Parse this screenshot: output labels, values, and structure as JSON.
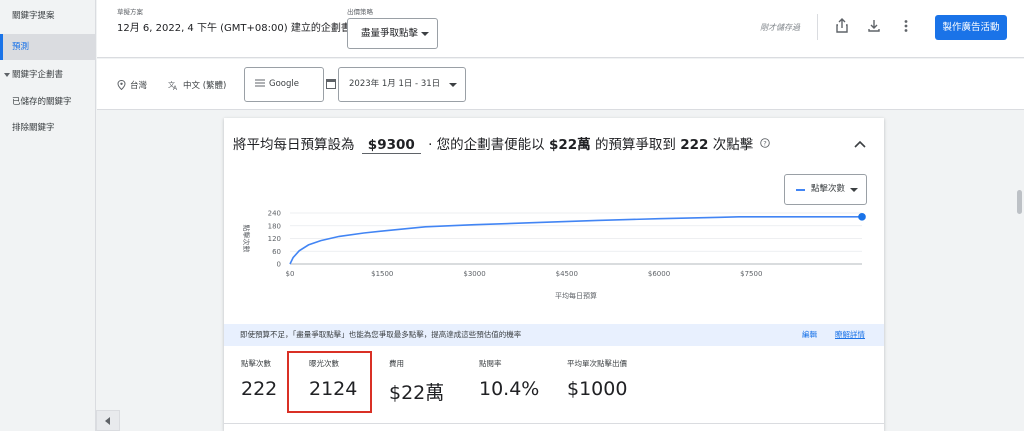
{
  "sidebar": {
    "items": [
      {
        "label": "關鍵字提案"
      },
      {
        "label": "預測",
        "active": true
      },
      {
        "label": "關鍵字企劃書"
      },
      {
        "label": "已儲存的關鍵字"
      },
      {
        "label": "排除關鍵字"
      }
    ]
  },
  "header": {
    "plan_label": "草擬方案",
    "plan_title": "12月 6, 2022, 4 下午 (GMT+08:00) 建立的企劃書",
    "strategy_label": "出價策略",
    "strategy_value": "盡量爭取點擊",
    "saved_text": "剛才儲存過",
    "create_button": "製作廣告活動"
  },
  "filters": {
    "location": "台灣",
    "language": "中文 (繁體)",
    "network": "Google",
    "date_range": "2023年 1月 1日 - 31日"
  },
  "forecast": {
    "headline_prefix": "將平均每日預算設為",
    "budget": "$9300",
    "headline_mid": "· 您的企劃書便能以",
    "spend": "$22萬",
    "headline_mid2": "的預算爭取到",
    "clicks": "222",
    "headline_suffix": "次點擊",
    "metric_select": "點擊次數",
    "info_text": "即使預算不足，「盡量爭取點擊」也能為您爭取最多點擊，提高達成這些預估值的機率",
    "info_edit": "編輯",
    "info_learn": "瞭解詳情"
  },
  "metrics": [
    {
      "label": "點擊次數",
      "value": "222"
    },
    {
      "label": "曝光次數",
      "value": "2124"
    },
    {
      "label": "費用",
      "value": "$22萬"
    },
    {
      "label": "點閱率",
      "value": "10.4%"
    },
    {
      "label": "平均單次點擊出價",
      "value": "$1000"
    }
  ],
  "chart_data": {
    "type": "line",
    "xlabel": "平均每日預算",
    "ylabel": "點擊次數",
    "x_ticks": [
      "$0",
      "$1500",
      "$3000",
      "$4500",
      "$6000",
      "$7500"
    ],
    "x_tick_values": [
      0,
      1500,
      3000,
      4500,
      6000,
      7500
    ],
    "y_ticks": [
      "0",
      "60",
      "120",
      "180",
      "240"
    ],
    "y_tick_values": [
      0,
      60,
      120,
      180,
      240
    ],
    "xlim": [
      0,
      9300
    ],
    "ylim": [
      0,
      240
    ],
    "series": [
      {
        "name": "點擊次數",
        "color": "#4285f4",
        "x": [
          0,
          50,
          150,
          300,
          500,
          800,
          1200,
          1600,
          2200,
          3000,
          4000,
          5000,
          6000,
          7000,
          7300,
          8000,
          9300
        ],
        "y": [
          0,
          30,
          62,
          90,
          110,
          130,
          146,
          158,
          175,
          185,
          195,
          205,
          213,
          220,
          222,
          222,
          222
        ]
      }
    ],
    "highlight_point": {
      "x": 9300,
      "y": 222
    },
    "grid": true
  }
}
